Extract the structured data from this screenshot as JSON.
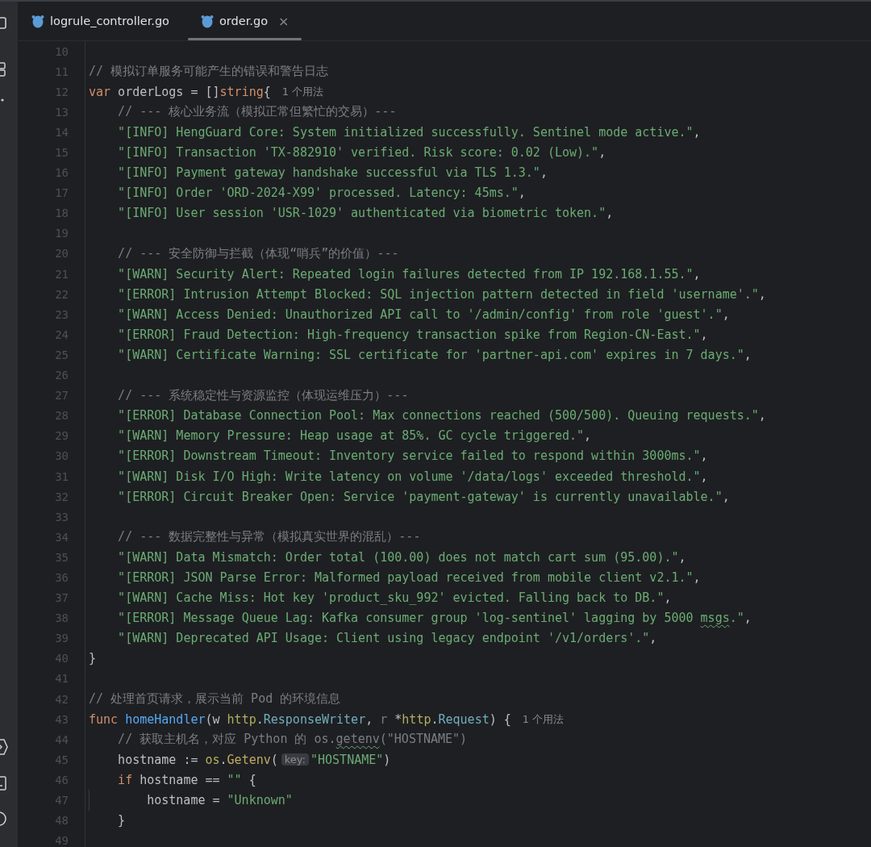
{
  "tabs": [
    {
      "label": "logrule_controller.go",
      "selected": false
    },
    {
      "label": "order.go",
      "selected": true,
      "close": "×"
    }
  ],
  "lines": [
    {
      "n": "10",
      "kind": "top"
    },
    {
      "n": "11",
      "kind": "top",
      "tokens": [
        {
          "kind": "comment",
          "text": "// 模拟订单服务可能产生的错误和警告日志"
        }
      ]
    },
    {
      "n": "12",
      "kind": "top",
      "tokens": [
        {
          "kind": "kw",
          "text": "var"
        },
        {
          "kind": "plain",
          "text": " orderLogs = []"
        },
        {
          "kind": "kw",
          "text": "string"
        },
        {
          "kind": "plain",
          "text": "{"
        },
        {
          "kind": "hint",
          "text": "1 个用法"
        }
      ]
    },
    {
      "n": "13",
      "kind": "inner",
      "tokens": [
        {
          "kind": "comment",
          "text": "// --- 核心业务流（模拟正常但繁忙的交易）---"
        }
      ]
    },
    {
      "n": "14",
      "kind": "inner",
      "tokens": [
        {
          "kind": "str",
          "text": "\"[INFO] HengGuard Core: System initialized successfully. Sentinel mode active.\""
        },
        {
          "kind": "plain",
          "text": ","
        }
      ]
    },
    {
      "n": "15",
      "kind": "inner",
      "tokens": [
        {
          "kind": "str",
          "text": "\"[INFO] Transaction 'TX-882910' verified. Risk score: 0.02 (Low).\""
        },
        {
          "kind": "plain",
          "text": ","
        }
      ]
    },
    {
      "n": "16",
      "kind": "inner",
      "tokens": [
        {
          "kind": "str",
          "text": "\"[INFO] Payment gateway handshake successful via TLS 1.3.\""
        },
        {
          "kind": "plain",
          "text": ","
        }
      ]
    },
    {
      "n": "17",
      "kind": "inner",
      "tokens": [
        {
          "kind": "str",
          "text": "\"[INFO] Order 'ORD-2024-X99' processed. Latency: 45ms.\""
        },
        {
          "kind": "plain",
          "text": ","
        }
      ]
    },
    {
      "n": "18",
      "kind": "inner",
      "tokens": [
        {
          "kind": "str",
          "text": "\"[INFO] User session 'USR-1029' authenticated via biometric token.\""
        },
        {
          "kind": "plain",
          "text": ","
        }
      ]
    },
    {
      "n": "19",
      "kind": "top"
    },
    {
      "n": "20",
      "kind": "inner",
      "tokens": [
        {
          "kind": "comment",
          "text": "// --- 安全防御与拦截（体现“哨兵”的价值）---"
        }
      ]
    },
    {
      "n": "21",
      "kind": "inner",
      "tokens": [
        {
          "kind": "str",
          "text": "\"[WARN] Security Alert: Repeated login failures detected from IP 192.168.1.55.\""
        },
        {
          "kind": "plain",
          "text": ","
        }
      ]
    },
    {
      "n": "22",
      "kind": "inner",
      "tokens": [
        {
          "kind": "str",
          "text": "\"[ERROR] Intrusion Attempt Blocked: SQL injection pattern detected in field 'username'.\""
        },
        {
          "kind": "plain",
          "text": ","
        }
      ]
    },
    {
      "n": "23",
      "kind": "inner",
      "tokens": [
        {
          "kind": "str",
          "text": "\"[WARN] Access Denied: Unauthorized API call to '/admin/config' from role 'guest'.\""
        },
        {
          "kind": "plain",
          "text": ","
        }
      ]
    },
    {
      "n": "24",
      "kind": "inner",
      "tokens": [
        {
          "kind": "str",
          "text": "\"[ERROR] Fraud Detection: High-frequency transaction spike from Region-CN-East.\""
        },
        {
          "kind": "plain",
          "text": ","
        }
      ]
    },
    {
      "n": "25",
      "kind": "inner",
      "tokens": [
        {
          "kind": "str",
          "text": "\"[WARN] Certificate Warning: SSL certificate for 'partner-api.com' expires in 7 days.\""
        },
        {
          "kind": "plain",
          "text": ","
        }
      ]
    },
    {
      "n": "26",
      "kind": "top"
    },
    {
      "n": "27",
      "kind": "inner",
      "tokens": [
        {
          "kind": "comment",
          "text": "// --- 系统稳定性与资源监控（体现运维压力）---"
        }
      ]
    },
    {
      "n": "28",
      "kind": "inner",
      "tokens": [
        {
          "kind": "str",
          "text": "\"[ERROR] Database Connection Pool: Max connections reached (500/500). Queuing requests.\""
        },
        {
          "kind": "plain",
          "text": ","
        }
      ]
    },
    {
      "n": "29",
      "kind": "inner",
      "tokens": [
        {
          "kind": "str",
          "text": "\"[WARN] Memory Pressure: Heap usage at 85%. GC cycle triggered.\""
        },
        {
          "kind": "plain",
          "text": ","
        }
      ]
    },
    {
      "n": "30",
      "kind": "inner",
      "tokens": [
        {
          "kind": "str",
          "text": "\"[ERROR] Downstream Timeout: Inventory service failed to respond within 3000ms.\""
        },
        {
          "kind": "plain",
          "text": ","
        }
      ]
    },
    {
      "n": "31",
      "kind": "inner",
      "tokens": [
        {
          "kind": "str",
          "text": "\"[WARN] Disk I/O High: Write latency on volume '/data/logs' exceeded threshold.\""
        },
        {
          "kind": "plain",
          "text": ","
        }
      ]
    },
    {
      "n": "32",
      "kind": "inner",
      "tokens": [
        {
          "kind": "str",
          "text": "\"[ERROR] Circuit Breaker Open: Service 'payment-gateway' is currently unavailable.\""
        },
        {
          "kind": "plain",
          "text": ","
        }
      ]
    },
    {
      "n": "33",
      "kind": "top"
    },
    {
      "n": "34",
      "kind": "inner",
      "tokens": [
        {
          "kind": "comment",
          "text": "// --- 数据完整性与异常（模拟真实世界的混乱）---"
        }
      ]
    },
    {
      "n": "35",
      "kind": "inner",
      "tokens": [
        {
          "kind": "str",
          "text": "\"[WARN] Data Mismatch: Order total (100.00) does not match cart sum (95.00).\""
        },
        {
          "kind": "plain",
          "text": ","
        }
      ]
    },
    {
      "n": "36",
      "kind": "inner",
      "tokens": [
        {
          "kind": "str",
          "text": "\"[ERROR] JSON Parse Error: Malformed payload received from mobile client v2.1.\""
        },
        {
          "kind": "plain",
          "text": ","
        }
      ]
    },
    {
      "n": "37",
      "kind": "inner",
      "tokens": [
        {
          "kind": "str",
          "text": "\"[WARN] Cache Miss: Hot key 'product_sku_992' evicted. Falling back to DB.\""
        },
        {
          "kind": "plain",
          "text": ","
        }
      ]
    },
    {
      "n": "38",
      "kind": "inner",
      "tokens": [
        {
          "kind": "str",
          "text": "\"[ERROR] Message Queue Lag: Kafka consumer group 'log-sentinel' lagging by 5000 "
        },
        {
          "kind": "str_typo",
          "text": "msgs"
        },
        {
          "kind": "str",
          "text": ".\""
        },
        {
          "kind": "plain",
          "text": ","
        }
      ]
    },
    {
      "n": "39",
      "kind": "inner",
      "tokens": [
        {
          "kind": "str",
          "text": "\"[WARN] Deprecated API Usage: Client using legacy endpoint '/v1/orders'.\""
        },
        {
          "kind": "plain",
          "text": ","
        }
      ]
    },
    {
      "n": "40",
      "kind": "top",
      "tokens": [
        {
          "kind": "plain",
          "text": "}"
        }
      ]
    },
    {
      "n": "41",
      "kind": "top"
    },
    {
      "n": "42",
      "kind": "top",
      "tokens": [
        {
          "kind": "comment",
          "text": "// 处理首页请求，展示当前 Pod 的环境信息"
        }
      ]
    },
    {
      "n": "43",
      "kind": "top",
      "tokens": [
        {
          "kind": "kw",
          "text": "func"
        },
        {
          "kind": "func",
          "text": "homeHandler"
        },
        {
          "kind": "plain",
          "text": "(w "
        },
        {
          "kind": "pkg",
          "text": "http"
        },
        {
          "kind": "plain",
          "text": "."
        },
        {
          "kind": "type",
          "text": "ResponseWriter"
        },
        {
          "kind": "plain",
          "text": ", "
        },
        {
          "kind": "unused",
          "text": "r"
        },
        {
          "kind": "plain",
          "text": " *"
        },
        {
          "kind": "pkg",
          "text": "http"
        },
        {
          "kind": "plain",
          "text": "."
        },
        {
          "kind": "type",
          "text": "Request"
        },
        {
          "kind": "plain",
          "text": ") {"
        },
        {
          "kind": "hint",
          "text": "1 个用法"
        }
      ]
    },
    {
      "n": "44",
      "kind": "inner",
      "tokens": [
        {
          "kind": "comment",
          "text": "// 获取主机名，对应 Python 的 os."
        },
        {
          "kind": "comment_typo",
          "text": "getenv"
        },
        {
          "kind": "comment",
          "text": "(\"HOSTNAME\")"
        }
      ]
    },
    {
      "n": "45",
      "kind": "inner",
      "tokens": [
        {
          "kind": "plain",
          "text": "hostname := "
        },
        {
          "kind": "pkg",
          "text": "os"
        },
        {
          "kind": "plain",
          "text": "."
        },
        {
          "kind": "call",
          "text": "Getenv"
        },
        {
          "kind": "plain",
          "text": "("
        },
        {
          "kind": "inlay",
          "text": "key:"
        },
        {
          "kind": "str",
          "text": "\"HOSTNAME\""
        },
        {
          "kind": "plain",
          "text": ")"
        }
      ]
    },
    {
      "n": "46",
      "kind": "inner",
      "tokens": [
        {
          "kind": "kw",
          "text": "if"
        },
        {
          "kind": "plain",
          "text": " hostname == "
        },
        {
          "kind": "str",
          "text": "\"\""
        },
        {
          "kind": "plain",
          "text": " {"
        }
      ]
    },
    {
      "n": "47",
      "kind": "inner2",
      "tokens": [
        {
          "kind": "plain",
          "text": "hostname = "
        },
        {
          "kind": "str",
          "text": "\"Unknown\""
        }
      ]
    },
    {
      "n": "48",
      "kind": "inner",
      "tokens": [
        {
          "kind": "plain",
          "text": "}"
        }
      ]
    },
    {
      "n": "49",
      "kind": "top"
    }
  ]
}
